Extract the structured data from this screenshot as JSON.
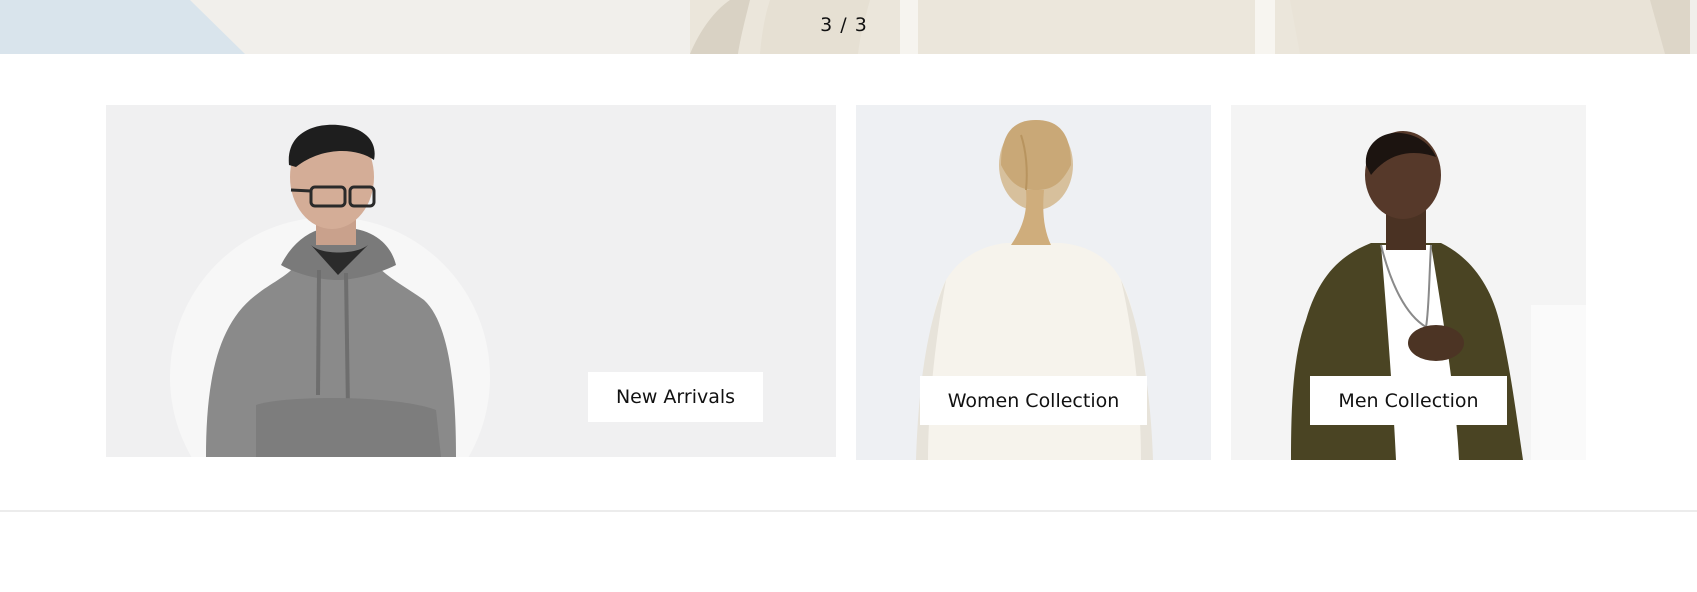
{
  "hero": {
    "slide_counter": "3 / 3"
  },
  "categories": [
    {
      "label": "New Arrivals",
      "image": "man-in-grey-hoodie-with-glasses"
    },
    {
      "label": "Women Collection",
      "image": "woman-back-cream-sweater"
    },
    {
      "label": "Men Collection",
      "image": "man-olive-jacket-white-tee"
    }
  ],
  "colors": {
    "background": "#ffffff",
    "label_background": "#ffffff",
    "banner_background": "#f0f0f0",
    "divider": "#ececec"
  }
}
